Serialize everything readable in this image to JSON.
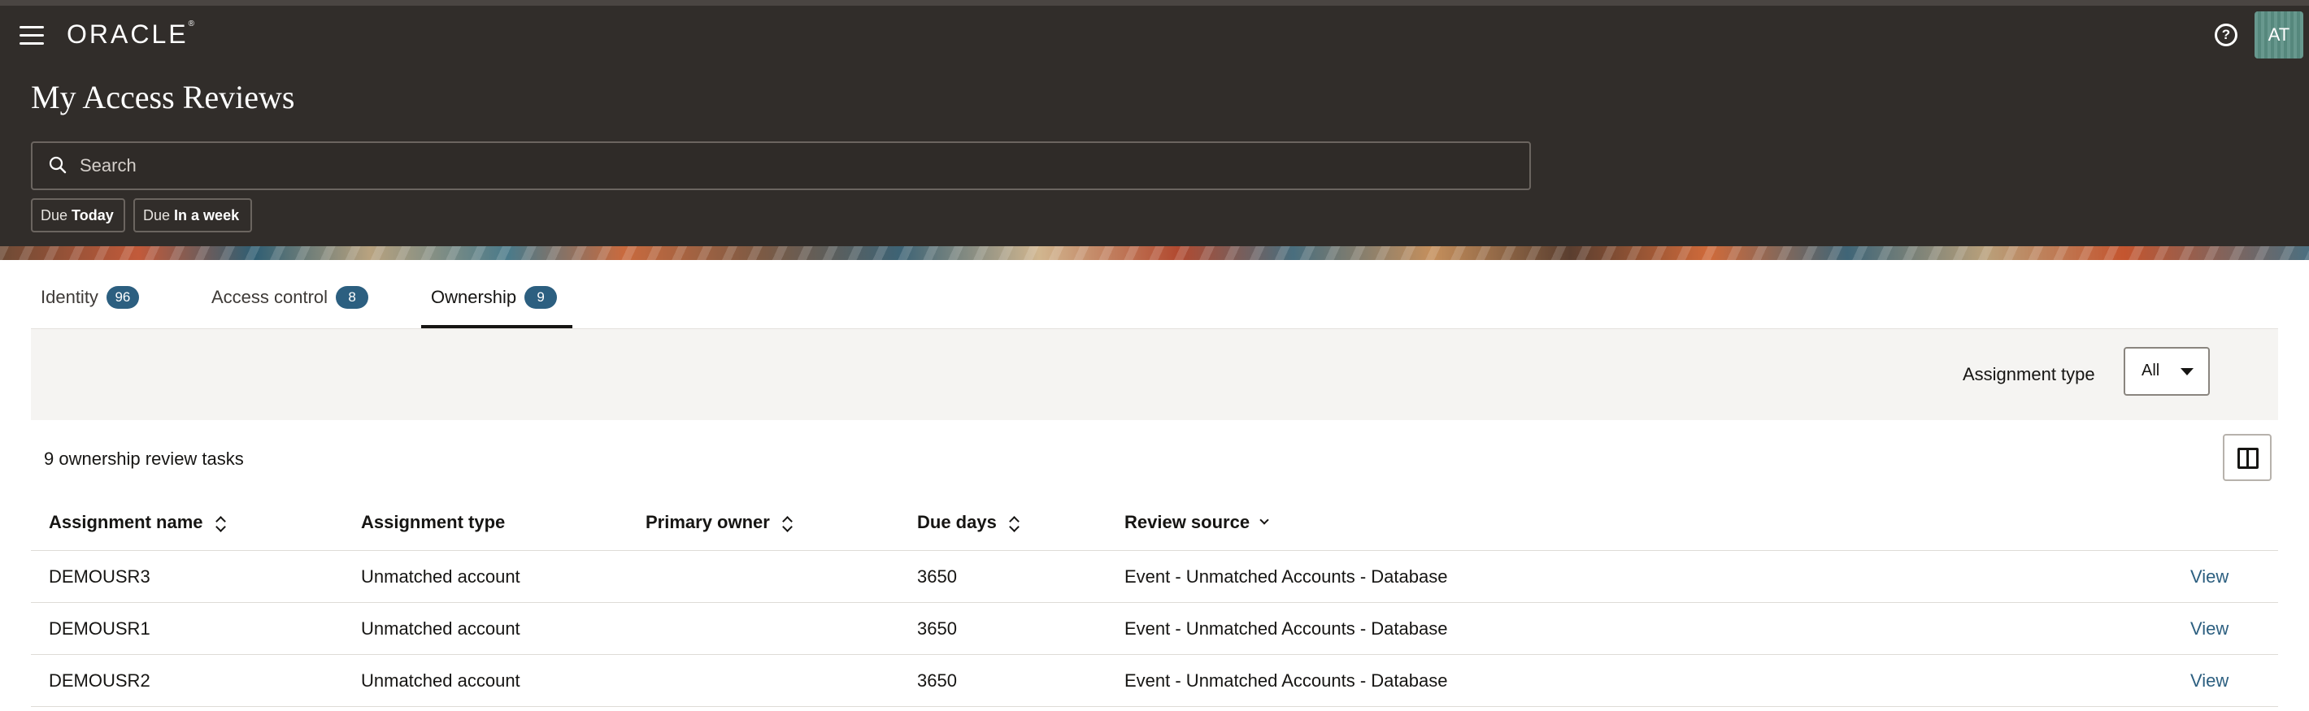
{
  "header": {
    "brand": "ORACLE",
    "brand_mark": "®",
    "title": "My Access Reviews",
    "avatar_initials": "AT",
    "help_glyph": "?",
    "search_placeholder": "Search",
    "chips": [
      {
        "prefix": "Due",
        "value": "Today"
      },
      {
        "prefix": "Due",
        "value": "In a week"
      }
    ]
  },
  "tabs": [
    {
      "label": "Identity",
      "count": "96",
      "active": false
    },
    {
      "label": "Access control",
      "count": "8",
      "active": false
    },
    {
      "label": "Ownership",
      "count": "9",
      "active": true
    }
  ],
  "filter": {
    "label": "Assignment type",
    "selected": "All"
  },
  "results": {
    "count_text": "9 ownership review tasks",
    "columns": [
      "Assignment name",
      "Assignment type",
      "Primary owner",
      "Due days",
      "Review source"
    ],
    "rows": [
      {
        "name": "DEMOUSR3",
        "type": "Unmatched account",
        "owner": "",
        "due": "3650",
        "source": "Event - Unmatched Accounts - Database",
        "action": "View"
      },
      {
        "name": "DEMOUSR1",
        "type": "Unmatched account",
        "owner": "",
        "due": "3650",
        "source": "Event - Unmatched Accounts - Database",
        "action": "View"
      },
      {
        "name": "DEMOUSR2",
        "type": "Unmatched account",
        "owner": "",
        "due": "3650",
        "source": "Event - Unmatched Accounts - Database",
        "action": "View"
      }
    ]
  },
  "colors": {
    "header_bg": "#312d2a",
    "badge_bg": "#2c5f80",
    "link": "#2c5f80"
  }
}
